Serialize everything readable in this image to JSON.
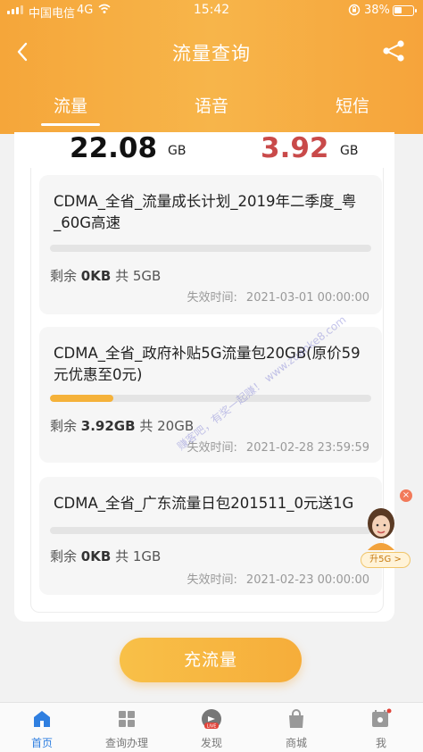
{
  "status_bar": {
    "carrier": "中国电信",
    "network": "4G",
    "time": "15:42",
    "battery": "38%",
    "battery_level": 0.38
  },
  "nav": {
    "title": "流量查询",
    "back_icon": "chevron-left-icon",
    "share_icon": "share-icon"
  },
  "tabs": [
    {
      "label": "流量",
      "active": true
    },
    {
      "label": "语音",
      "active": false
    },
    {
      "label": "短信",
      "active": false
    }
  ],
  "summary": {
    "total_value": "22.08",
    "total_unit": "GB",
    "remain_value": "3.92",
    "remain_unit": "GB",
    "remain_color": "#c94a4a"
  },
  "packages": [
    {
      "name": "CDMA_全省_流量成长计划_2019年二季度_粤_60G高速",
      "remain_label": "剩余",
      "remain_value": "0KB",
      "total_label": "共",
      "total_value": "5GB",
      "progress": 0.0,
      "expire_label": "失效时间:",
      "expire_time": "2021-03-01 00:00:00"
    },
    {
      "name": "CDMA_全省_政府补贴5G流量包20GB(原价59元优惠至0元)",
      "remain_label": "剩余",
      "remain_value": "3.92GB",
      "total_label": "共",
      "total_value": "20GB",
      "progress": 0.196,
      "expire_label": "失效时间:",
      "expire_time": "2021-02-28 23:59:59"
    },
    {
      "name": "CDMA_全省_广东流量日包201511_0元送1G",
      "remain_label": "剩余",
      "remain_value": "0KB",
      "total_label": "共",
      "total_value": "1GB",
      "progress": 0.0,
      "expire_label": "失效时间:",
      "expire_time": "2021-02-23 00:00:00"
    }
  ],
  "watermark": "赚客吧，有奖一起赚！ www.zuanke8.com",
  "assistant": {
    "badge": "升5G >",
    "close": "×"
  },
  "recharge_label": "充流量",
  "bottom_nav": [
    {
      "label": "首页",
      "icon": "home-icon",
      "active": true
    },
    {
      "label": "查询办理",
      "icon": "grid-icon",
      "active": false
    },
    {
      "label": "发现",
      "icon": "live-icon",
      "active": false
    },
    {
      "label": "商城",
      "icon": "shop-bag-icon",
      "active": false
    },
    {
      "label": "我",
      "icon": "calendar-user-icon",
      "active": false
    }
  ],
  "colors": {
    "accent": "#f6a93d",
    "active_nav": "#2f7fe0",
    "progress": "#f5b23a"
  }
}
